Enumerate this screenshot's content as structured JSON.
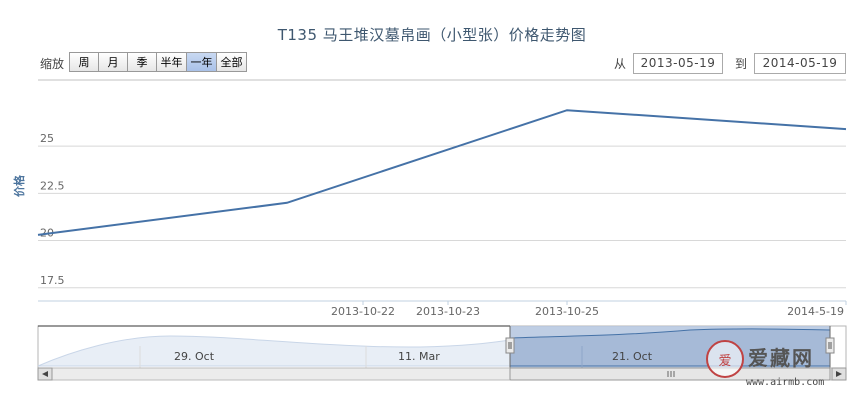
{
  "title": "T135 马王堆汉墓帛画（小型张）价格走势图",
  "zoom": {
    "label": "缩放",
    "buttons": [
      "周",
      "月",
      "季",
      "半年",
      "一年",
      "全部"
    ],
    "active": "一年"
  },
  "range": {
    "from_label": "从",
    "from_value": "2013-05-19",
    "to_label": "到",
    "to_value": "2014-05-19"
  },
  "colors": {
    "line": "#4572a7",
    "navigator_fill": "#b4c6df",
    "navigator_bg": "#e8eef6",
    "grid": "#d8d8d8"
  },
  "chart_data": {
    "type": "line",
    "ylabel": "价格",
    "ylim": [
      16.8,
      28.5
    ],
    "yticks": [
      17.5,
      20,
      22.5,
      25
    ],
    "x": [
      "2013-05-19",
      "2013-10-22",
      "2013-10-25",
      "2014-05-19"
    ],
    "x_tick_labels": [
      "2013-10-22",
      "2013-10-23",
      "2013-10-25",
      "2014-5-19"
    ],
    "series": [
      {
        "values": [
          20.3,
          22,
          26.9,
          25.9
        ]
      }
    ]
  },
  "navigator": {
    "labels": [
      "29. Oct",
      "11. Mar",
      "21. Oct"
    ]
  },
  "watermark": {
    "name": "爱藏网",
    "url": "www.airmb.com",
    "seal_text": "爱"
  }
}
